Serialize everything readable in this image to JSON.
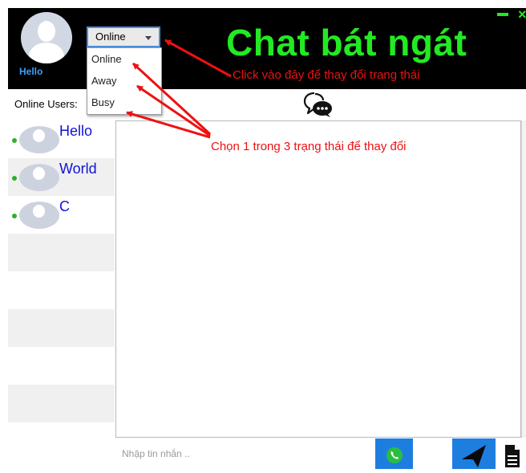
{
  "header": {
    "user_name": "Hello",
    "status_selected": "Online",
    "status_options": [
      "Online",
      "Away",
      "Busy"
    ],
    "app_title": "Chat bát ngát",
    "hint_click": "Click vào đây để thay đổi trang thái"
  },
  "sidebar": {
    "online_label": "Online Users:",
    "users": [
      {
        "name": "Hello",
        "status": "online"
      },
      {
        "name": "World",
        "status": "online"
      },
      {
        "name": "C",
        "status": "online"
      }
    ]
  },
  "chat": {
    "hint_choose": "Chọn 1 trong 3 trạng thái để thay đổi"
  },
  "composer": {
    "placeholder": "Nhập tin nhắn .."
  },
  "colors": {
    "title_green": "#22ea22",
    "annotation_red": "#ee1111",
    "button_blue": "#1e7ee0",
    "username_blue": "#3aa0ff",
    "user_list_blue": "#1212d6",
    "online_green": "#2fae2f"
  },
  "icons": {
    "chat_bubbles": "chat-bubbles-icon",
    "phone": "phone-icon",
    "send": "paper-plane-icon",
    "file": "document-icon"
  }
}
